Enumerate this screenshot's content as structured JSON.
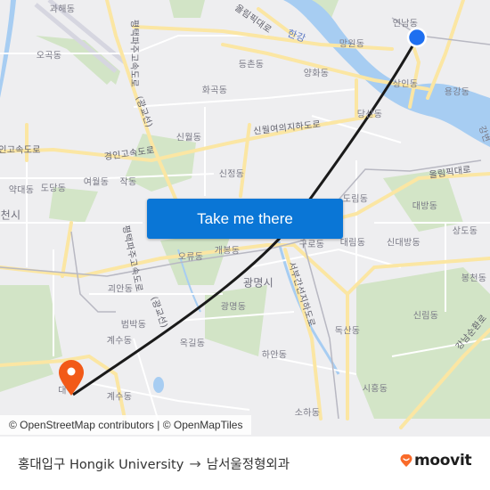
{
  "map": {
    "labels": {
      "gwahae": "과해동",
      "ogok": "오곡동",
      "hwagok": "화곡동",
      "deungchon": "등촌동",
      "yeonnam": "연남동",
      "mangwon": "망원동",
      "yanghwa": "양화동",
      "hangang": "한강",
      "sangin": "상인동",
      "yonggang": "용강동",
      "dangsan": "당산동",
      "sinwol": "신월동",
      "sinjeong": "신정동",
      "yeowol": "여월동",
      "jak": "작동",
      "yakdae": "약대동",
      "dodang": "도당동",
      "bucheon": "천시",
      "ori": "오류동",
      "gaebong": "개봉동",
      "goean": "괴안동",
      "gwangmyeong_si": "광명시",
      "gwangmyeong_dong": "광명동",
      "beombak": "범박동",
      "gyesu1": "계수동",
      "okgil": "옥길동",
      "gyesu2": "계수동",
      "dorim": "도림동",
      "daebang": "대방동",
      "sangdo": "상도동",
      "guro": "구로동",
      "daerim": "대림동",
      "sindaebang": "신대방동",
      "bongcheon": "봉천동",
      "sillim": "신림동",
      "doksan": "독산동",
      "haan": "하안동",
      "siheung": "시흥동",
      "soha": "소하동",
      "gangbyeon": "강변",
      "dae": "대"
    },
    "roads": {
      "olympic1": "올림픽대로",
      "olympic2": "올림픽대로",
      "pyeongtaek1": "평택파주고속도로",
      "pyeongtaek1_sub": "(광교선)",
      "pyeongtaek2": "평택파주고속도로",
      "pyeongtaek2_sub": "(광교선)",
      "gyeongin1": "인고속도로",
      "gyeongin2": "경인고속도로",
      "sinwol_underpass": "신월여의지하도로",
      "seobu": "서부간선지하도로",
      "gangnam_sunhwan": "강남순환로"
    },
    "origin_color": "#1e6ff0",
    "destination_color": "#f25a18",
    "route_color": "#1a1a1a"
  },
  "cta": {
    "label": "Take me there"
  },
  "attribution": {
    "text": "© OpenStreetMap contributors | © OpenMapTiles"
  },
  "footer": {
    "origin": "홍대입구 Hongik University",
    "arrow": "→",
    "destination": "남서울정형외과",
    "brand": "moovit",
    "brand_color": "#f96b2a"
  }
}
